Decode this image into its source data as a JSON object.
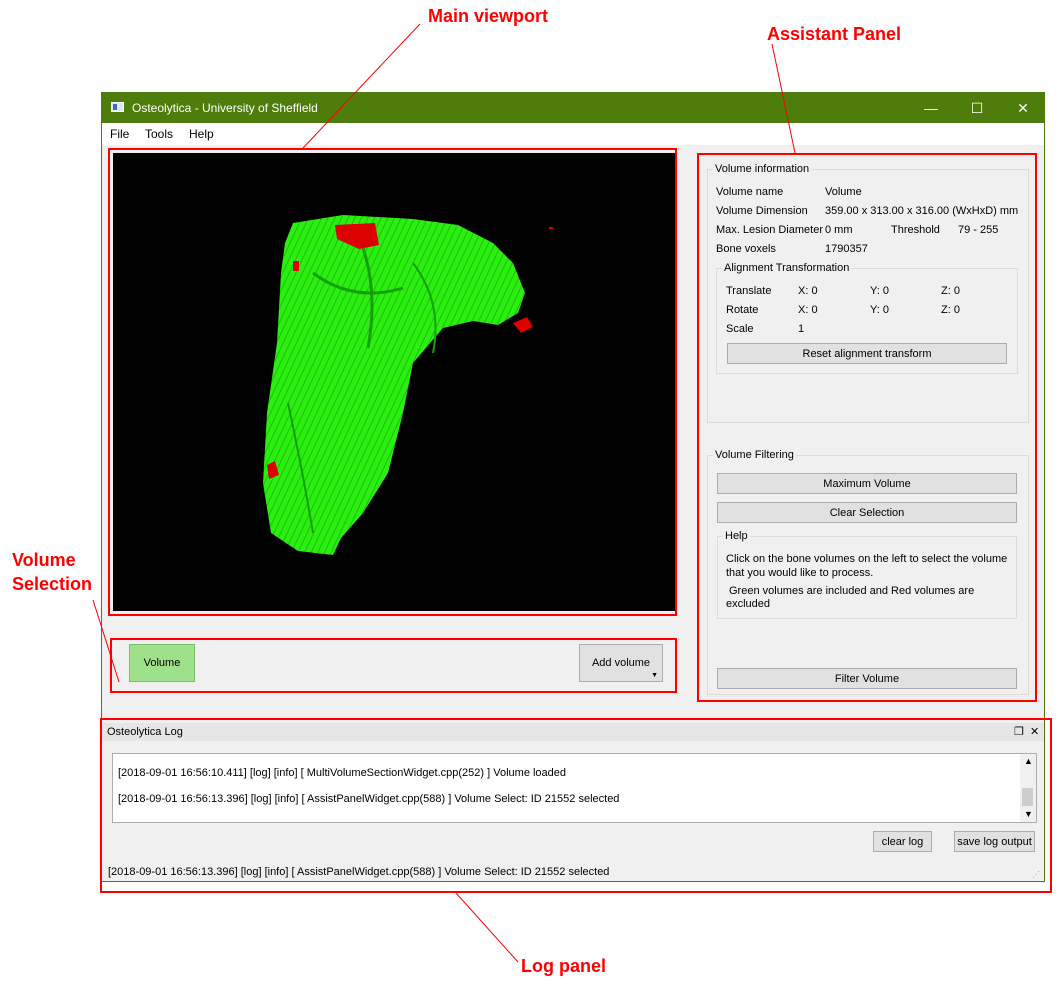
{
  "annotations": {
    "main_viewport": "Main viewport",
    "assistant_panel": "Assistant Panel",
    "volume_selection_line1": "Volume",
    "volume_selection_line2": "Selection",
    "log_panel": "Log panel"
  },
  "window": {
    "title": "Osteolytica - University of Sheffield",
    "minimize": "—",
    "maximize": "☐",
    "close": "✕"
  },
  "menu": {
    "file": "File",
    "tools": "Tools",
    "help": "Help"
  },
  "volume_selection": {
    "volume_button": "Volume",
    "add_volume_button": "Add volume"
  },
  "volume_info": {
    "title": "Volume information",
    "name_label": "Volume name",
    "name_value": "Volume",
    "dimension_label": "Volume Dimension",
    "dimension_value": "359.00 x 313.00 x 316.00 (WxHxD) mm",
    "lesion_label": "Max. Lesion Diameter",
    "lesion_value": "0 mm",
    "threshold_label": "Threshold",
    "threshold_value": "79 - 255",
    "bone_label": "Bone voxels",
    "bone_value": "1790357"
  },
  "alignment": {
    "title": "Alignment Transformation",
    "translate_label": "Translate",
    "translate_x": "X: 0",
    "translate_y": "Y: 0",
    "translate_z": "Z: 0",
    "rotate_label": "Rotate",
    "rotate_x": "X: 0",
    "rotate_y": "Y: 0",
    "rotate_z": "Z: 0",
    "scale_label": "Scale",
    "scale_value": "1",
    "reset_button": "Reset alignment transform"
  },
  "filtering": {
    "title": "Volume Filtering",
    "max_volume_button": "Maximum Volume",
    "clear_selection_button": "Clear Selection",
    "help_title": "Help",
    "help_line1": "Click on the bone volumes on the left to select the volume",
    "help_line2": "that you would like to process.",
    "help_line3": "Green volumes are included and Red volumes are",
    "help_line4": "excluded",
    "filter_button": "Filter Volume"
  },
  "log": {
    "title": "Osteolytica Log",
    "entries": [
      "[2018-09-01 16:56:10.411] [log] [info] [ MultiVolumeSectionWidget.cpp(252) ] Volume loaded",
      "[2018-09-01 16:56:13.396] [log] [info] [ AssistPanelWidget.cpp(588) ] Volume Select: ID 21552 selected"
    ],
    "clear_button": "clear log",
    "save_button": "save log output",
    "status": "[2018-09-01 16:56:13.396] [log] [info] [ AssistPanelWidget.cpp(588) ] Volume Select: ID 21552 selected"
  },
  "colors": {
    "titlebar": "#4f7d0c",
    "bone_included": "#22ee00",
    "bone_excluded": "#dd0000",
    "annotation": "#ff0000",
    "volume_button": "#9fe08b"
  }
}
